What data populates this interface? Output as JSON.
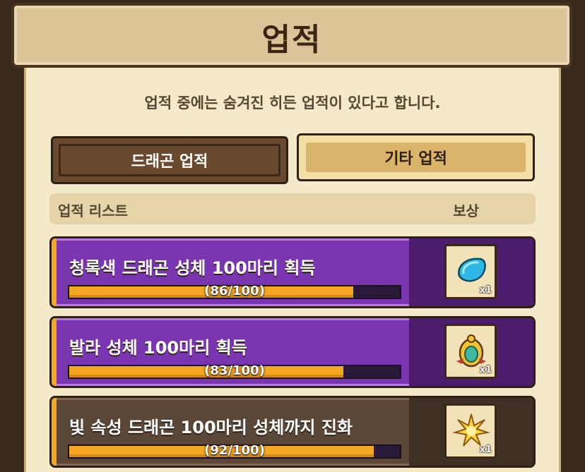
{
  "header": {
    "title": "업적"
  },
  "description": "업적 중에는 숨겨진 히든 업적이 있다고 합니다.",
  "tabs": [
    {
      "label": "드래곤 업적",
      "active": false
    },
    {
      "label": "기타 업적",
      "active": true
    }
  ],
  "list_header": {
    "left": "업적 리스트",
    "right": "보상"
  },
  "achievements": [
    {
      "title": "청록색 드래곤 성체 100마리 획득",
      "current": 86,
      "total": 100,
      "progress_text": "(86/100)",
      "reward_icon": "blue-gem-icon",
      "reward_qty": "x1",
      "style": "purple"
    },
    {
      "title": "발라 성체 100마리 획득",
      "current": 83,
      "total": 100,
      "progress_text": "(83/100)",
      "reward_icon": "golden-egg-icon",
      "reward_qty": "x1",
      "style": "purple"
    },
    {
      "title": "빛 속성 드래곤 100마리 성체까지 진화",
      "current": 92,
      "total": 100,
      "progress_text": "(92/100)",
      "reward_icon": "light-burst-icon",
      "reward_qty": "x1",
      "style": "brown"
    }
  ]
}
